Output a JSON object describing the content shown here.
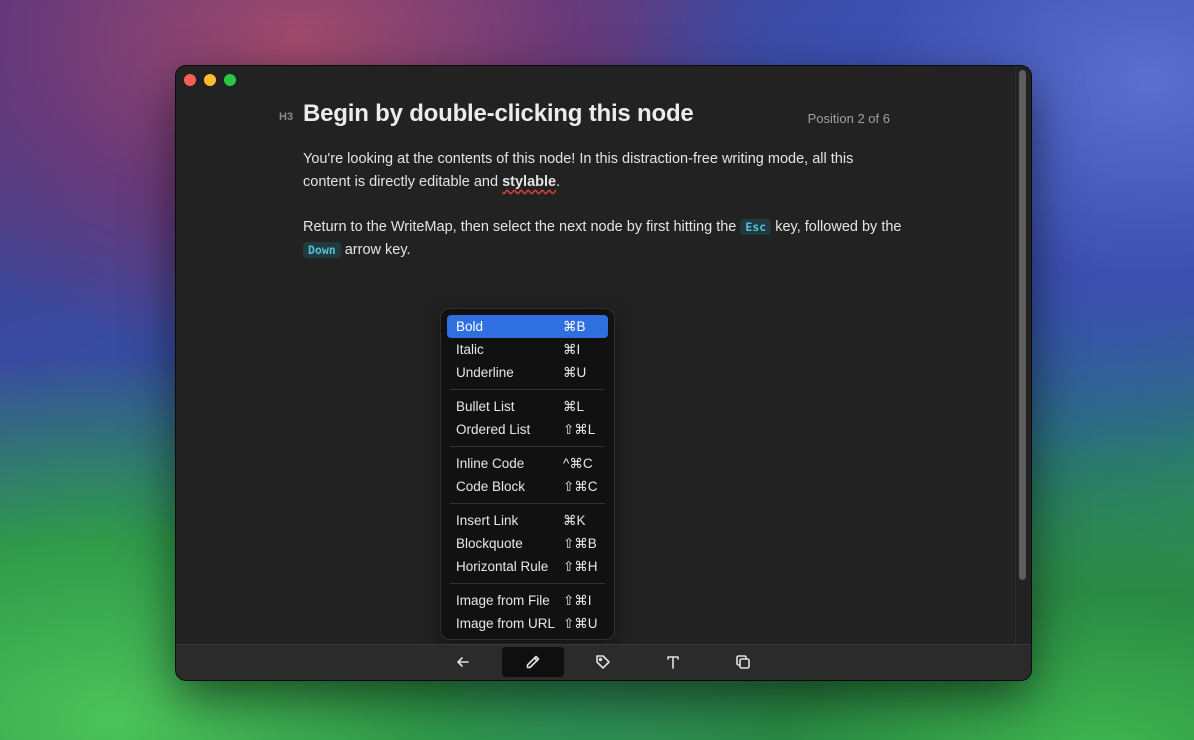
{
  "editor": {
    "heading_level": "H3",
    "title": "Begin by double-clicking this node",
    "position": "Position 2 of 6",
    "para1_a": "You're looking at the contents of this node! In this distraction-free writing mode, all this content is directly editable and ",
    "para1_b": "stylable",
    "para1_c": ".",
    "para2_a": "Return to the WriteMap, then select the next node by first hitting the ",
    "para2_key1": "Esc",
    "para2_b": " key, followed by the ",
    "para2_key2": "Down",
    "para2_c": " arrow key."
  },
  "menu": {
    "groups": [
      [
        {
          "label": "Bold",
          "shortcut": "⌘B"
        },
        {
          "label": "Italic",
          "shortcut": "⌘I"
        },
        {
          "label": "Underline",
          "shortcut": "⌘U"
        }
      ],
      [
        {
          "label": "Bullet List",
          "shortcut": "⌘L"
        },
        {
          "label": "Ordered List",
          "shortcut": "⇧⌘L"
        }
      ],
      [
        {
          "label": "Inline Code",
          "shortcut": "^⌘C"
        },
        {
          "label": "Code Block",
          "shortcut": "⇧⌘C"
        }
      ],
      [
        {
          "label": "Insert Link",
          "shortcut": "⌘K"
        },
        {
          "label": "Blockquote",
          "shortcut": "⇧⌘B"
        },
        {
          "label": "Horizontal Rule",
          "shortcut": "⇧⌘H"
        }
      ],
      [
        {
          "label": "Image from File",
          "shortcut": "⇧⌘I"
        },
        {
          "label": "Image from URL",
          "shortcut": "⇧⌘U"
        }
      ]
    ]
  },
  "toolbar": {
    "tools": [
      {
        "icon": "arrow-left-icon",
        "active": false
      },
      {
        "icon": "pencil-icon",
        "active": true
      },
      {
        "icon": "tag-icon",
        "active": false
      },
      {
        "icon": "text-icon",
        "active": false
      },
      {
        "icon": "copy-icon",
        "active": false
      }
    ]
  },
  "colors": {
    "accent": "#2f6fe0",
    "window_bg": "#222222",
    "code_text": "#4fc3d8"
  }
}
